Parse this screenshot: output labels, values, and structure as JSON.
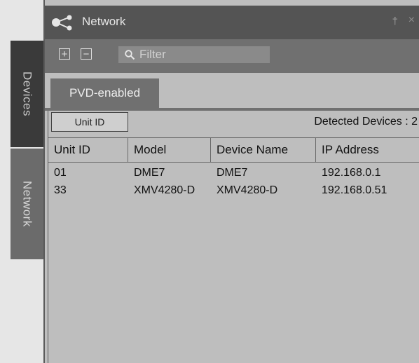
{
  "side_tabs": [
    {
      "label": "Devices"
    },
    {
      "label": "Network"
    }
  ],
  "window": {
    "title": "Network",
    "pin_glyph": "†",
    "close_glyph": "×"
  },
  "toolbar": {
    "expand_glyph": "+",
    "collapse_glyph": "−",
    "filter_placeholder": "Filter"
  },
  "tabs": [
    {
      "label": "PVD-enabled"
    }
  ],
  "grid": {
    "sort_button_label": "Unit ID",
    "detected_text": "Detected Devices : 2",
    "columns": [
      "Unit ID",
      "Model",
      "Device Name",
      "IP Address"
    ],
    "rows": [
      [
        "01",
        "DME7",
        "DME7",
        "192.168.0.1"
      ],
      [
        "33",
        "XMV4280-D",
        "XMV4280-D",
        "192.168.0.51"
      ]
    ]
  },
  "colors": {
    "titlebar": "#545454",
    "toolbar": "#707070",
    "panel": "#bebebe",
    "side_tab_active": "#3a3a3a"
  }
}
